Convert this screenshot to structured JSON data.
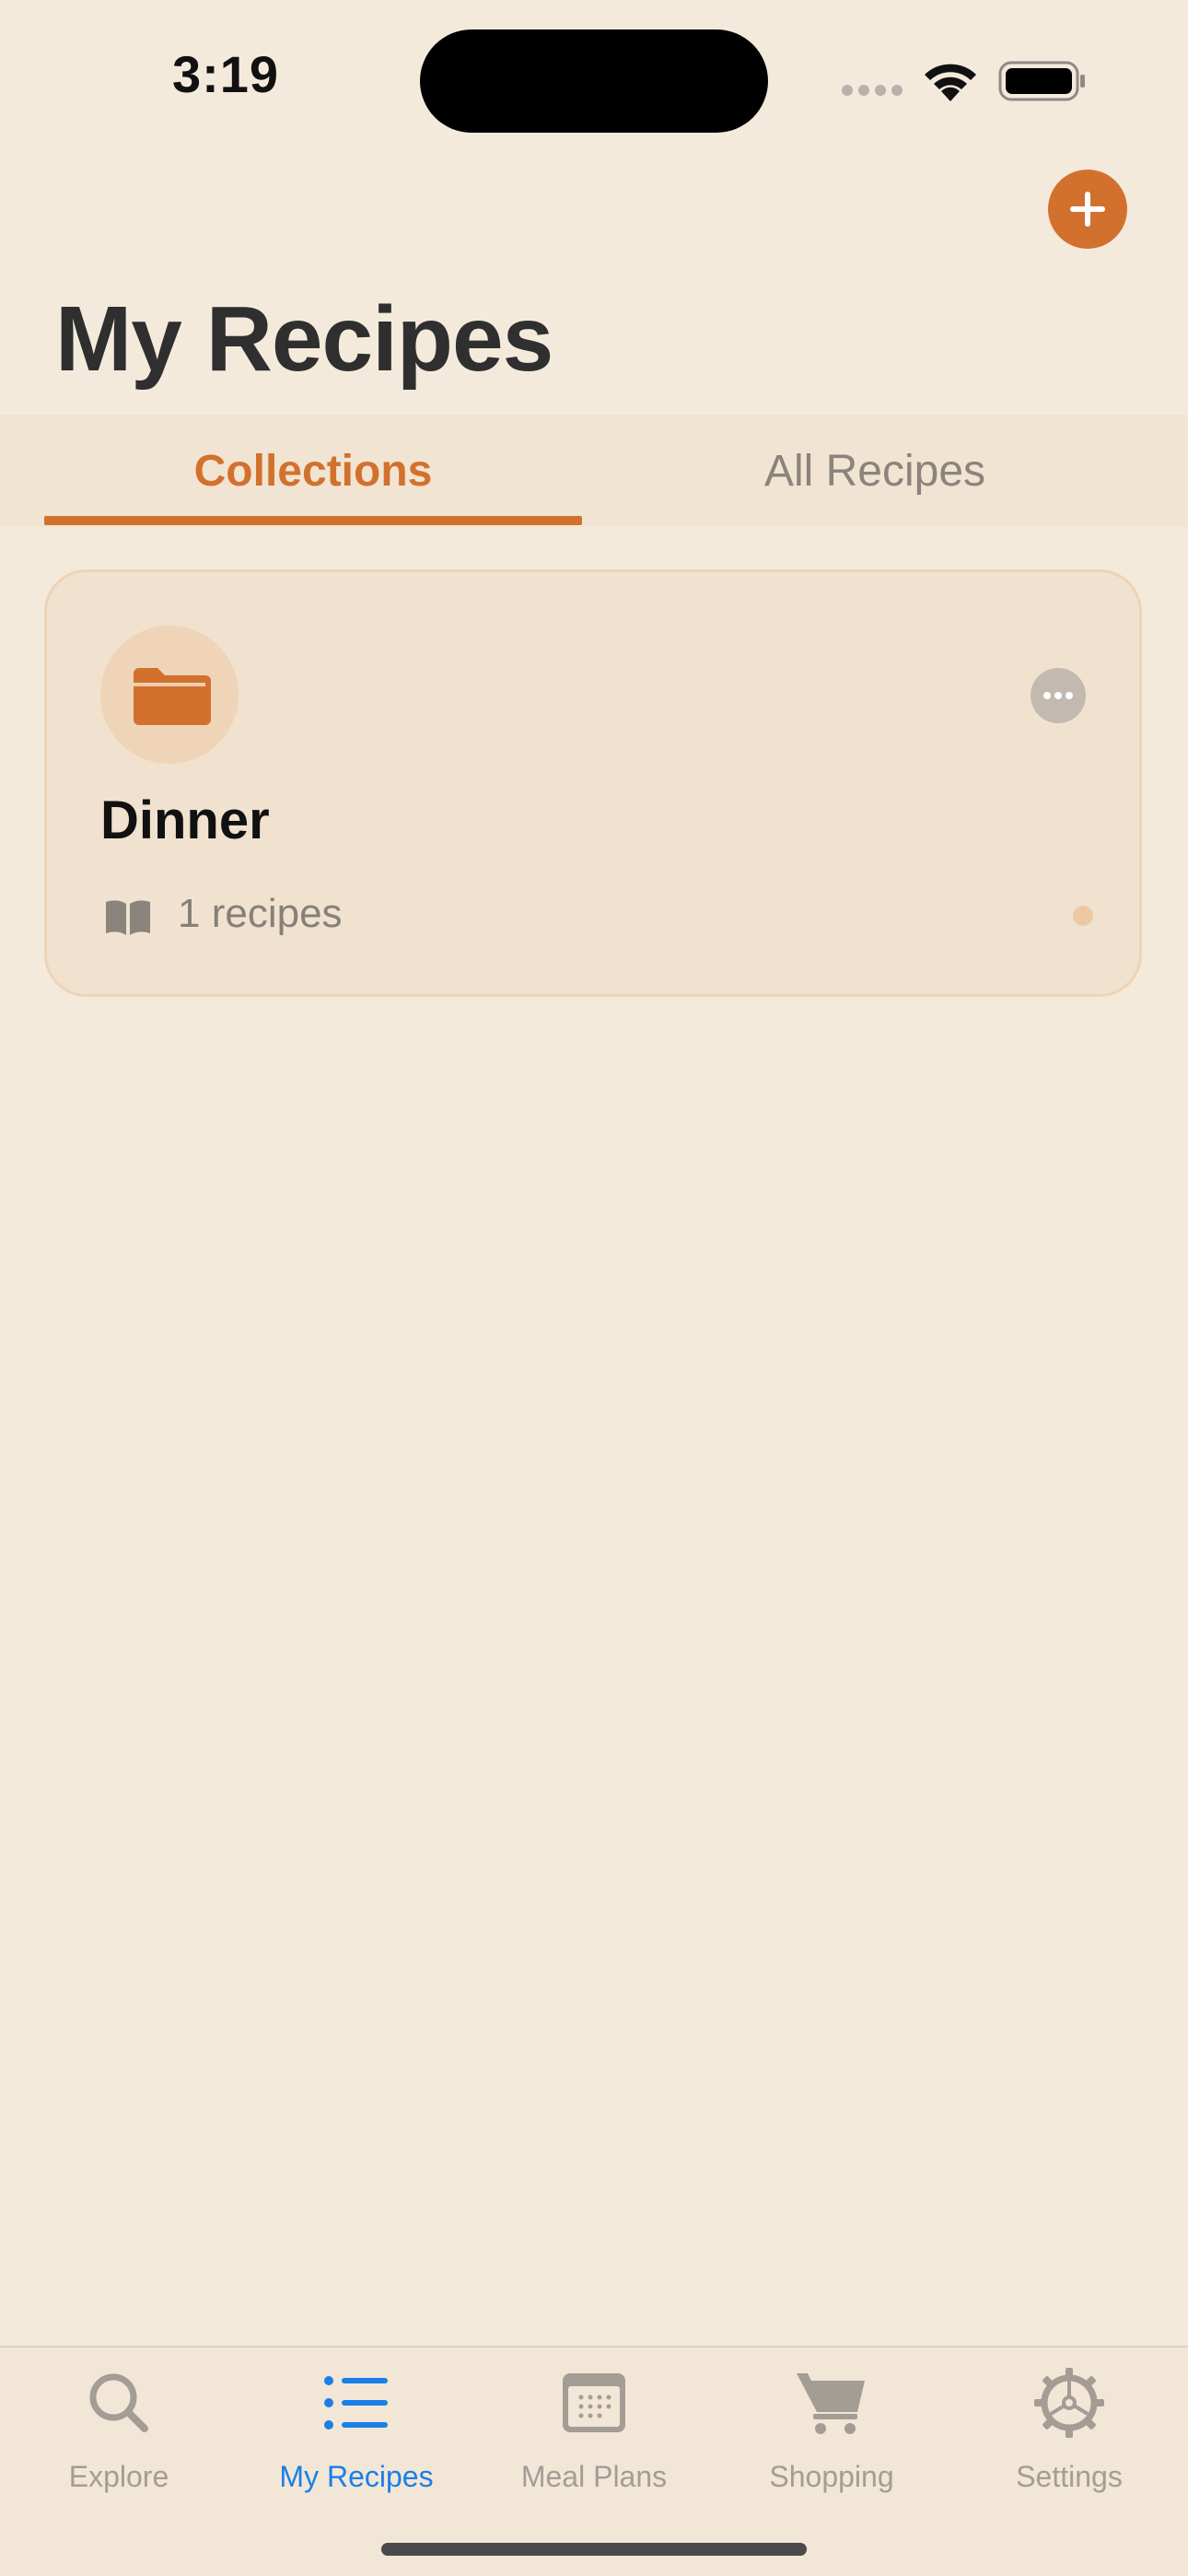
{
  "status_bar": {
    "time": "3:19"
  },
  "header": {
    "title": "My Recipes"
  },
  "tabs": [
    {
      "label": "Collections",
      "active": true
    },
    {
      "label": "All Recipes",
      "active": false
    }
  ],
  "collections": [
    {
      "name": "Dinner",
      "count_text": "1 recipes",
      "icon": "folder-icon"
    }
  ],
  "bottom_nav": [
    {
      "label": "Explore",
      "icon": "magnifier-icon",
      "active": false
    },
    {
      "label": "My Recipes",
      "icon": "list-icon",
      "active": true
    },
    {
      "label": "Meal Plans",
      "icon": "calendar-icon",
      "active": false
    },
    {
      "label": "Shopping",
      "icon": "cart-icon",
      "active": false
    },
    {
      "label": "Settings",
      "icon": "gear-icon",
      "active": false
    }
  ],
  "colors": {
    "accent": "#D2712E",
    "background": "#F4EADC",
    "active_nav": "#1A7FE8",
    "inactive_nav": "#A39D95"
  }
}
